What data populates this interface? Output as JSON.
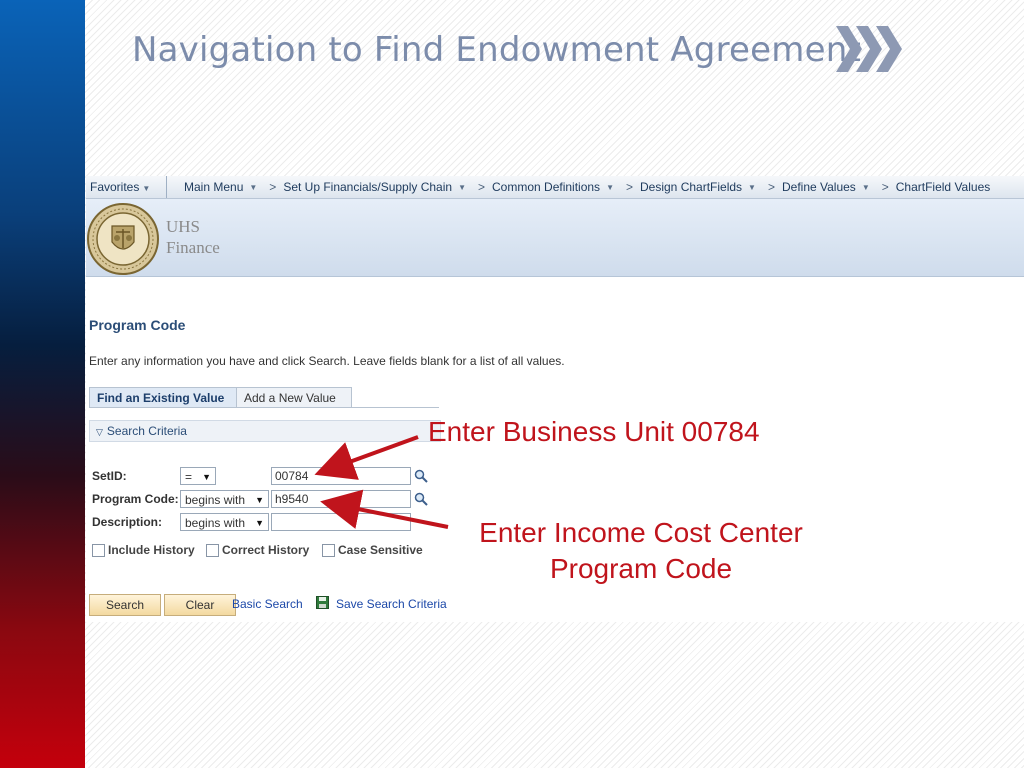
{
  "slide": {
    "title": "Navigation to Find Endowment Agreement",
    "accent_sidebar_top": "#0a63b8",
    "accent_sidebar_bottom": "#c4000c",
    "title_color": "#7c8cab"
  },
  "nav": {
    "favorites": "Favorites",
    "breadcrumbs": [
      "Main Menu",
      "Set Up Financials/Supply Chain",
      "Common Definitions",
      "Design ChartFields",
      "Define Values",
      "ChartField Values"
    ]
  },
  "brand": {
    "line1": "UHS",
    "line2": "Finance",
    "seal_icon": "university-seal-icon"
  },
  "page": {
    "title": "Program Code",
    "instructions": "Enter any information you have and click Search. Leave fields blank for a list of all values."
  },
  "tabs": {
    "find": "Find an Existing Value",
    "add": "Add a New Value"
  },
  "criteria": {
    "header": "Search Criteria",
    "fields": [
      {
        "label": "SetID:",
        "operator": "=",
        "value": ""
      },
      {
        "label": "Program Code:",
        "operator": "begins with",
        "value": ""
      },
      {
        "label": "Description:",
        "operator": "begins with",
        "value": ""
      }
    ],
    "setid_value": "00784",
    "program_value": "h9540",
    "checkboxes": [
      "Include History",
      "Correct History",
      "Case Sensitive"
    ]
  },
  "buttons": {
    "search": "Search",
    "clear": "Clear",
    "basic_search": "Basic Search",
    "save_criteria": "Save Search Criteria"
  },
  "annotations": {
    "business_unit": "Enter Business Unit 00784",
    "income_line1": "Enter Income Cost Center",
    "income_line2": "Program Code",
    "color": "#c0141c"
  }
}
